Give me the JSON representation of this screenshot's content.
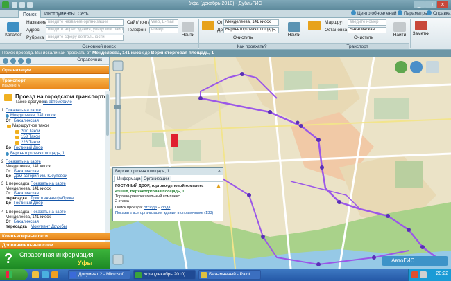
{
  "window": {
    "title": "Уфа (декабрь 2010) - ДубльГИС",
    "controls": [
      "_",
      "□",
      "×"
    ]
  },
  "ribbon_tabs": [
    "Поиск",
    "Инструменты",
    "Сеть"
  ],
  "ribbon_right": {
    "update_center": "Центр обновлений",
    "params": "Параметры",
    "help": "Справка"
  },
  "basic_search": {
    "catalog_label": "Каталог",
    "name_label": "Название",
    "name_placeholder": "введите название организации",
    "address_label": "Адрес",
    "address_placeholder": "введите адрес здания, улицу или район",
    "rubric_label": "Рубрика",
    "rubric_placeholder": "введите сферу деятельности",
    "website_label": "Сайт/почта",
    "website_placeholder": "Web, E-mail",
    "phone_label": "Телефон",
    "phone_placeholder": "номер",
    "find_label": "Найти",
    "group_label": "Основной поиск"
  },
  "how_to_get": {
    "from_label": "От",
    "from_value": "Менделеева, 141 киоск",
    "to_label": "До",
    "to_value": "Верхнеторговая площадь, 1",
    "clear_label": "Очистить",
    "find_label": "Найти",
    "group_label": "Как проехать?"
  },
  "transport": {
    "route_label": "Маршрут",
    "route_placeholder": "введите номер",
    "stop_label": "Остановка",
    "stop_value": "Бакалинская",
    "clear_label": "Очистить",
    "find_label": "Найти",
    "group_label": "Транспорт"
  },
  "notes_label": "Заметки",
  "statusline": {
    "prefix": "Поиск проезда. Вы искали как проехать от",
    "from": "Менделеева, 141 киоск",
    "middle": "до",
    "to": "Верхнеторговая площадь, 1"
  },
  "left_panel": {
    "toolbar_label": "Справочник",
    "sections": {
      "organizations": "Организации",
      "transport": "Транспорт",
      "found": "Найдено: 6",
      "computer_nets": "Компьютерные сети",
      "extra_layers": "Дополнительные слои"
    },
    "route_title": "Проезд на городском транспорте",
    "also_available_prefix": "Также доступен",
    "also_available_link": "на автомобиле",
    "results": [
      {
        "num": "1",
        "show_map": "Показать на карте",
        "from_stop": "Менделеева, 141 киоск",
        "from_label": "От",
        "from_link": "Бакалинская",
        "transport_type": "Маршрутное такси",
        "routes": [
          "207 Такси",
          "153 Такси",
          "226 Такси"
        ],
        "to_label": "До",
        "to_link": "Гостиный Двор",
        "dest": "Верхнеторговая площадь, 1"
      },
      {
        "num": "2",
        "show_map": "Показать на карте",
        "from_stop": "Менделеева, 141 киоск",
        "from_label": "От",
        "from_link": "Бакалинская",
        "to_label": "До",
        "to_link": "Дом-астерия им. Юсуповой"
      },
      {
        "num": "3",
        "transfers": "1 пересадка",
        "show_map": "Показать на карте",
        "from_stop": "Менделеева, 141 киоск",
        "from_label": "От",
        "from_link": "Бакалинская",
        "transfer_label": "пересадка",
        "transfer_link": "Трикотажная фабрика",
        "to_label": "До",
        "to_link": "Гостиный Двор"
      },
      {
        "num": "4",
        "transfers": "1 пересадка",
        "show_map": "Показать на карте",
        "from_stop": "Менделеева, 141 киоск",
        "from_label": "От",
        "from_link": "Бакалинская",
        "transfer_label": "пересадка",
        "transfer_link": "Монумент Дружбы"
      }
    ],
    "banner": {
      "line1": "Справочная информация",
      "line2": "Уфы"
    }
  },
  "popup": {
    "header": "Верхнеторговая площадь, 1",
    "tabs": [
      "Информация",
      "Организации"
    ],
    "title": "ГОСТИНЫЙ ДВОР, торгово-деловой комплекс",
    "address": "450008, Верхнеторговая площадь, 1",
    "type": "Торгово-развлекательный комплекс",
    "floors": "2 этажа",
    "search_prefix": "Поиск проезда:",
    "search_from": "отсюда",
    "search_dash": "–",
    "search_to": "сюда",
    "show_all": "Показать все организации здания в справочнике (133)"
  },
  "map_badge": "АвтоГИС",
  "taskbar": {
    "tasks": [
      "Документ 2 - Microsoft ...",
      "Уфа (декабрь 2010) ...",
      "Безымянный - Paint"
    ],
    "clock": "20:22"
  },
  "colors": {
    "accent_orange": "#ea8a1e",
    "route_purple": "#9b57e8",
    "link_blue": "#1656a8",
    "banner_green": "#2f9c2f"
  }
}
